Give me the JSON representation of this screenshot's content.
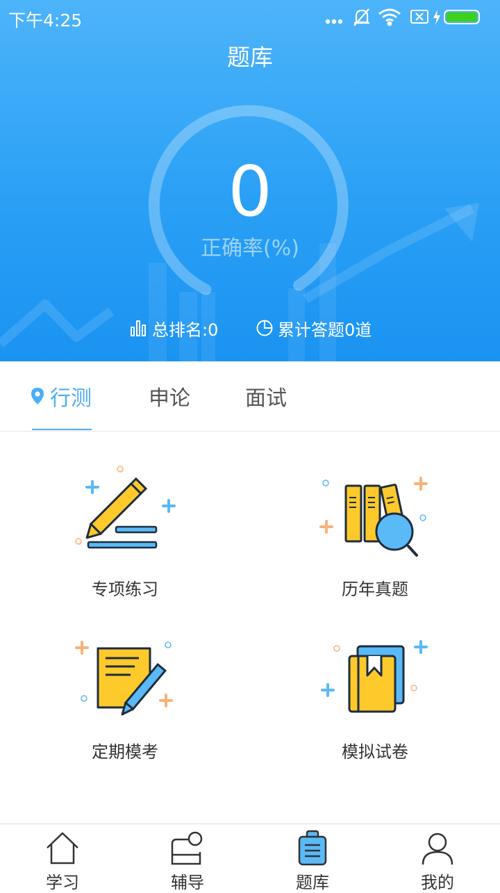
{
  "status_bar": {
    "time": "下午4:25",
    "icons": [
      "more-dots-icon",
      "bell-off-icon",
      "wifi-icon",
      "no-sim-icon",
      "charging-icon",
      "battery-icon"
    ],
    "battery_color": "#3cd11c"
  },
  "header": {
    "title": "题库"
  },
  "score": {
    "value": "0",
    "label": "正确率(%)",
    "accuracy_percent": 0
  },
  "stats": {
    "rank": "总排名:0",
    "answered": "累计答题0道"
  },
  "tabs": [
    {
      "label": "行测",
      "active": true,
      "icon": "location-pin-icon"
    },
    {
      "label": "申论",
      "active": false
    },
    {
      "label": "面试",
      "active": false
    }
  ],
  "features": [
    {
      "label": "专项练习",
      "icon": "pencil-practice-icon"
    },
    {
      "label": "历年真题",
      "icon": "books-search-icon"
    },
    {
      "label": "定期模考",
      "icon": "document-pen-icon"
    },
    {
      "label": "模拟试卷",
      "icon": "bookmark-book-icon"
    }
  ],
  "bottom_nav": [
    {
      "label": "学习",
      "icon": "home-icon"
    },
    {
      "label": "辅导",
      "icon": "tutoring-icon"
    },
    {
      "label": "题库",
      "icon": "clipboard-icon",
      "active": true
    },
    {
      "label": "我的",
      "icon": "person-icon"
    }
  ],
  "colors": {
    "accent": "#4aaef5",
    "hero_top": "#4db4fa",
    "hero_bottom": "#1a93f2",
    "icon_yellow": "#fdc92b",
    "icon_blue": "#5ab9f7",
    "icon_orange": "#f7b27a"
  }
}
